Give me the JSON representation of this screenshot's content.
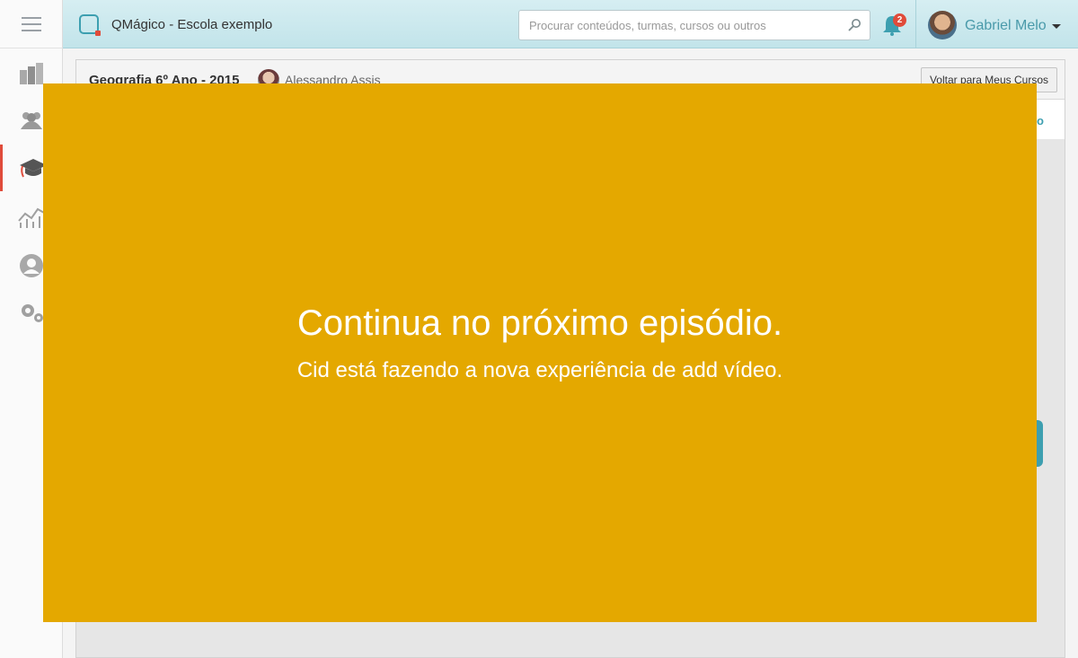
{
  "app": {
    "title": "QMágico - Escola exemplo"
  },
  "search": {
    "placeholder": "Procurar conteúdos, turmas, cursos ou outros"
  },
  "notifications": {
    "count": "2"
  },
  "user": {
    "name": "Gabriel Melo"
  },
  "sidebar": {
    "items": [
      {
        "icon": "books-icon"
      },
      {
        "icon": "people-icon"
      },
      {
        "icon": "graduation-cap-icon",
        "active": true
      },
      {
        "icon": "analytics-icon"
      },
      {
        "icon": "user-profile-icon"
      },
      {
        "icon": "gears-icon"
      }
    ]
  },
  "course": {
    "title": "Geografia 6º Ano - 2015",
    "teacher": "Alessandro Assis",
    "back_label": "Voltar para Meus Cursos",
    "tab_partial": "no"
  },
  "overlay": {
    "title": "Continua no próximo episódio.",
    "subtitle": "Cid está fazendo a nova experiência de add vídeo."
  },
  "colors": {
    "accent": "#3d9fb0",
    "overlay": "#e4a800",
    "badge": "#e04b3a"
  }
}
